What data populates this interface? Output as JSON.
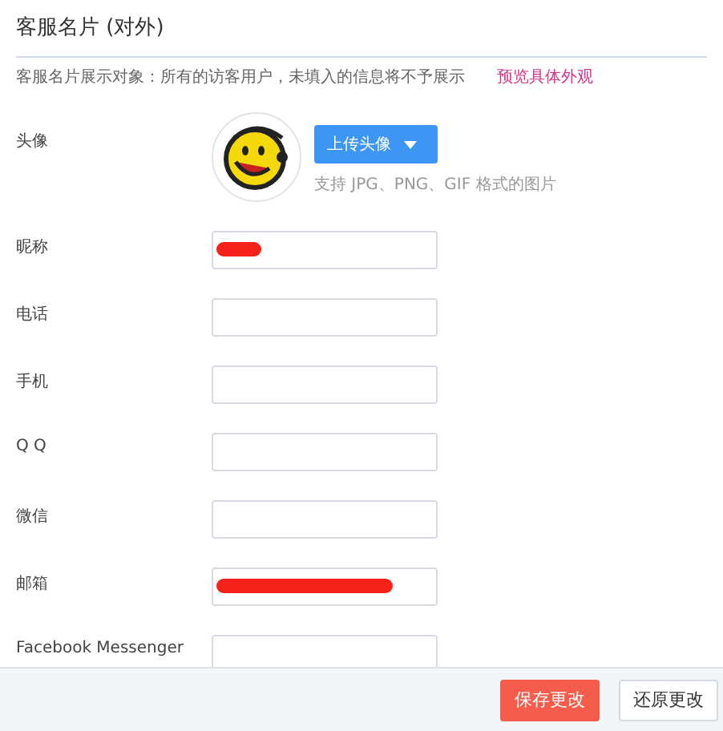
{
  "title": "客服名片 (对外)",
  "description": "客服名片展示对象：所有的访客用户，未填入的信息将不予展示",
  "preview_link": "预览具体外观",
  "avatar": {
    "label": "头像",
    "upload_button": "上传头像",
    "hint": "支持 JPG、PNG、GIF 格式的图片"
  },
  "fields": [
    {
      "label": "昵称",
      "redacted": true
    },
    {
      "label": "电话",
      "redacted": false
    },
    {
      "label": "手机",
      "redacted": false
    },
    {
      "label": "Q Q",
      "redacted": false
    },
    {
      "label": "微信",
      "redacted": false
    },
    {
      "label": "邮箱",
      "redacted": true
    },
    {
      "label": "Facebook Messenger",
      "redacted": false
    }
  ],
  "buttons": [
    {
      "label": "保存更改",
      "kind": "primary"
    },
    {
      "label": "还原更改",
      "kind": "secondary"
    }
  ]
}
